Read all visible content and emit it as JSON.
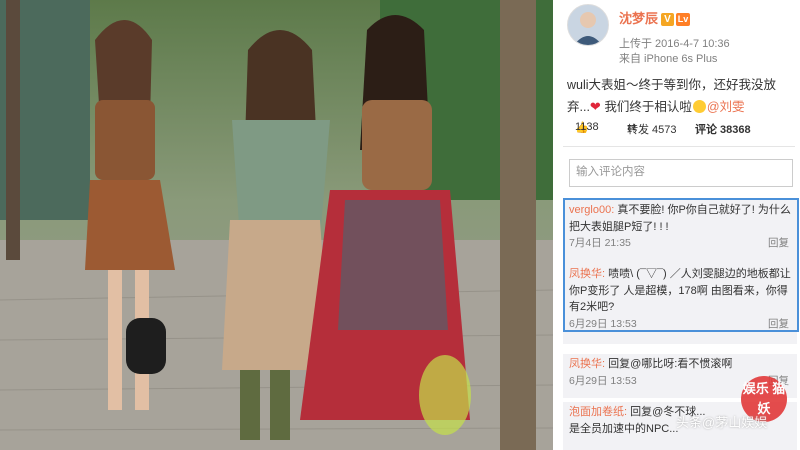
{
  "post": {
    "username": "沈梦辰",
    "v_badge": "V",
    "level_badge": "Lv",
    "upload_time": "上传于 2016-4-7 10:36",
    "device": "来自 iPhone 6s Plus",
    "text_line1": "wuli大表姐～终于等到你，还好我没放",
    "text_line2": "弃...",
    "text_line2_b": "我们终于相认啦",
    "mention": "@刘雯"
  },
  "actions": {
    "like_count": "1138",
    "repost_label": "转发 4573",
    "comment_label": "评论 38368"
  },
  "comment_input": {
    "placeholder": "输入评论内容"
  },
  "comments": [
    {
      "name": "verglo00:",
      "text": "真不要脸! 你P你自己就好了! 为什么把大表姐腿P短了! ! !",
      "time": "7月4日 21:35",
      "reply": "回复"
    },
    {
      "name": "凤换华:",
      "text": "啧啧\\ (¯▽¯) ／人刘雯腿边的地板都让你P变形了 人是超模，178啊 由图看来，你得有2米吧?",
      "time": "6月29日 13:53",
      "reply": "回复"
    },
    {
      "name": "凤换华:",
      "text": "回复@哪比呀:看不惯滚啊",
      "time": "6月29日 13:53",
      "reply": "回复"
    },
    {
      "name": "泡面加卷纸:",
      "text": "回复@冬不球...",
      "line2": "是全员加速中的NPC...",
      "time": "",
      "reply": ""
    }
  ],
  "watermark": {
    "text": "头条@茅山娱娱",
    "seal_text": "娱乐 猫妖"
  }
}
